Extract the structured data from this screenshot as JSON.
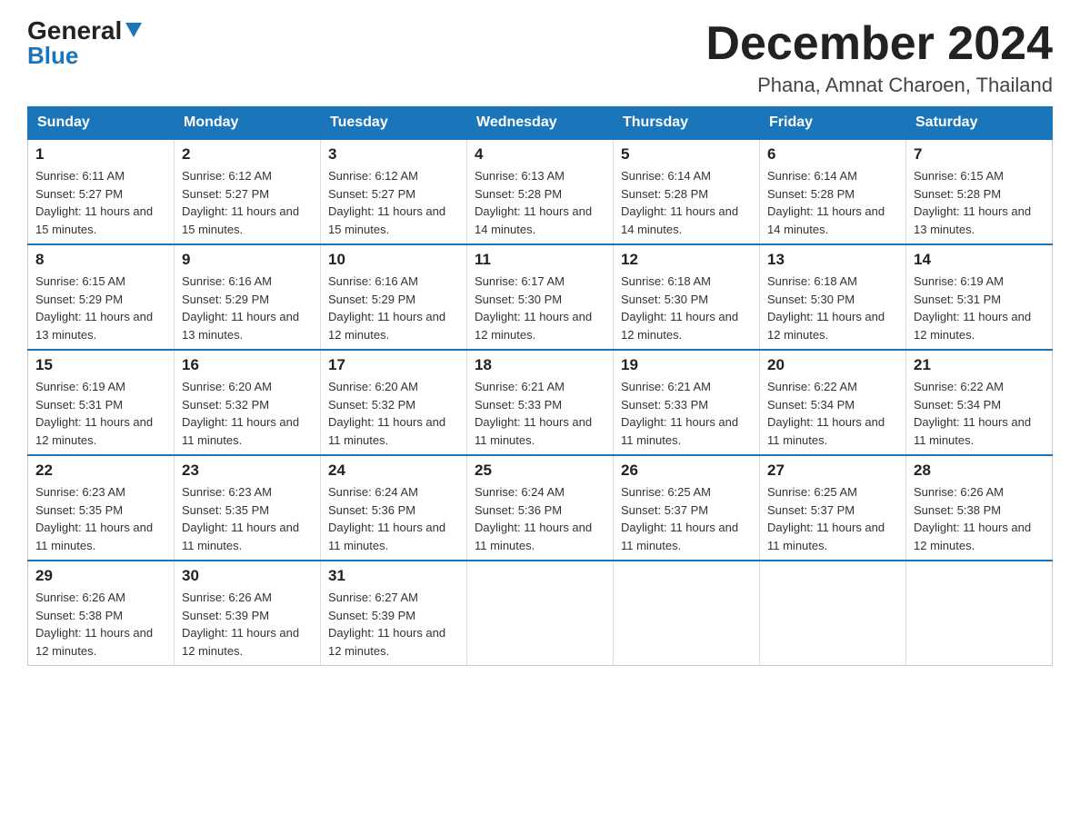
{
  "logo": {
    "text_general": "General",
    "text_blue": "Blue"
  },
  "title": "December 2024",
  "subtitle": "Phana, Amnat Charoen, Thailand",
  "days_of_week": [
    "Sunday",
    "Monday",
    "Tuesday",
    "Wednesday",
    "Thursday",
    "Friday",
    "Saturday"
  ],
  "weeks": [
    [
      {
        "day": "1",
        "sunrise": "6:11 AM",
        "sunset": "5:27 PM",
        "daylight": "11 hours and 15 minutes."
      },
      {
        "day": "2",
        "sunrise": "6:12 AM",
        "sunset": "5:27 PM",
        "daylight": "11 hours and 15 minutes."
      },
      {
        "day": "3",
        "sunrise": "6:12 AM",
        "sunset": "5:27 PM",
        "daylight": "11 hours and 15 minutes."
      },
      {
        "day": "4",
        "sunrise": "6:13 AM",
        "sunset": "5:28 PM",
        "daylight": "11 hours and 14 minutes."
      },
      {
        "day": "5",
        "sunrise": "6:14 AM",
        "sunset": "5:28 PM",
        "daylight": "11 hours and 14 minutes."
      },
      {
        "day": "6",
        "sunrise": "6:14 AM",
        "sunset": "5:28 PM",
        "daylight": "11 hours and 14 minutes."
      },
      {
        "day": "7",
        "sunrise": "6:15 AM",
        "sunset": "5:28 PM",
        "daylight": "11 hours and 13 minutes."
      }
    ],
    [
      {
        "day": "8",
        "sunrise": "6:15 AM",
        "sunset": "5:29 PM",
        "daylight": "11 hours and 13 minutes."
      },
      {
        "day": "9",
        "sunrise": "6:16 AM",
        "sunset": "5:29 PM",
        "daylight": "11 hours and 13 minutes."
      },
      {
        "day": "10",
        "sunrise": "6:16 AM",
        "sunset": "5:29 PM",
        "daylight": "11 hours and 12 minutes."
      },
      {
        "day": "11",
        "sunrise": "6:17 AM",
        "sunset": "5:30 PM",
        "daylight": "11 hours and 12 minutes."
      },
      {
        "day": "12",
        "sunrise": "6:18 AM",
        "sunset": "5:30 PM",
        "daylight": "11 hours and 12 minutes."
      },
      {
        "day": "13",
        "sunrise": "6:18 AM",
        "sunset": "5:30 PM",
        "daylight": "11 hours and 12 minutes."
      },
      {
        "day": "14",
        "sunrise": "6:19 AM",
        "sunset": "5:31 PM",
        "daylight": "11 hours and 12 minutes."
      }
    ],
    [
      {
        "day": "15",
        "sunrise": "6:19 AM",
        "sunset": "5:31 PM",
        "daylight": "11 hours and 12 minutes."
      },
      {
        "day": "16",
        "sunrise": "6:20 AM",
        "sunset": "5:32 PM",
        "daylight": "11 hours and 11 minutes."
      },
      {
        "day": "17",
        "sunrise": "6:20 AM",
        "sunset": "5:32 PM",
        "daylight": "11 hours and 11 minutes."
      },
      {
        "day": "18",
        "sunrise": "6:21 AM",
        "sunset": "5:33 PM",
        "daylight": "11 hours and 11 minutes."
      },
      {
        "day": "19",
        "sunrise": "6:21 AM",
        "sunset": "5:33 PM",
        "daylight": "11 hours and 11 minutes."
      },
      {
        "day": "20",
        "sunrise": "6:22 AM",
        "sunset": "5:34 PM",
        "daylight": "11 hours and 11 minutes."
      },
      {
        "day": "21",
        "sunrise": "6:22 AM",
        "sunset": "5:34 PM",
        "daylight": "11 hours and 11 minutes."
      }
    ],
    [
      {
        "day": "22",
        "sunrise": "6:23 AM",
        "sunset": "5:35 PM",
        "daylight": "11 hours and 11 minutes."
      },
      {
        "day": "23",
        "sunrise": "6:23 AM",
        "sunset": "5:35 PM",
        "daylight": "11 hours and 11 minutes."
      },
      {
        "day": "24",
        "sunrise": "6:24 AM",
        "sunset": "5:36 PM",
        "daylight": "11 hours and 11 minutes."
      },
      {
        "day": "25",
        "sunrise": "6:24 AM",
        "sunset": "5:36 PM",
        "daylight": "11 hours and 11 minutes."
      },
      {
        "day": "26",
        "sunrise": "6:25 AM",
        "sunset": "5:37 PM",
        "daylight": "11 hours and 11 minutes."
      },
      {
        "day": "27",
        "sunrise": "6:25 AM",
        "sunset": "5:37 PM",
        "daylight": "11 hours and 11 minutes."
      },
      {
        "day": "28",
        "sunrise": "6:26 AM",
        "sunset": "5:38 PM",
        "daylight": "11 hours and 12 minutes."
      }
    ],
    [
      {
        "day": "29",
        "sunrise": "6:26 AM",
        "sunset": "5:38 PM",
        "daylight": "11 hours and 12 minutes."
      },
      {
        "day": "30",
        "sunrise": "6:26 AM",
        "sunset": "5:39 PM",
        "daylight": "11 hours and 12 minutes."
      },
      {
        "day": "31",
        "sunrise": "6:27 AM",
        "sunset": "5:39 PM",
        "daylight": "11 hours and 12 minutes."
      },
      null,
      null,
      null,
      null
    ]
  ],
  "labels": {
    "sunrise": "Sunrise:",
    "sunset": "Sunset:",
    "daylight": "Daylight:"
  }
}
